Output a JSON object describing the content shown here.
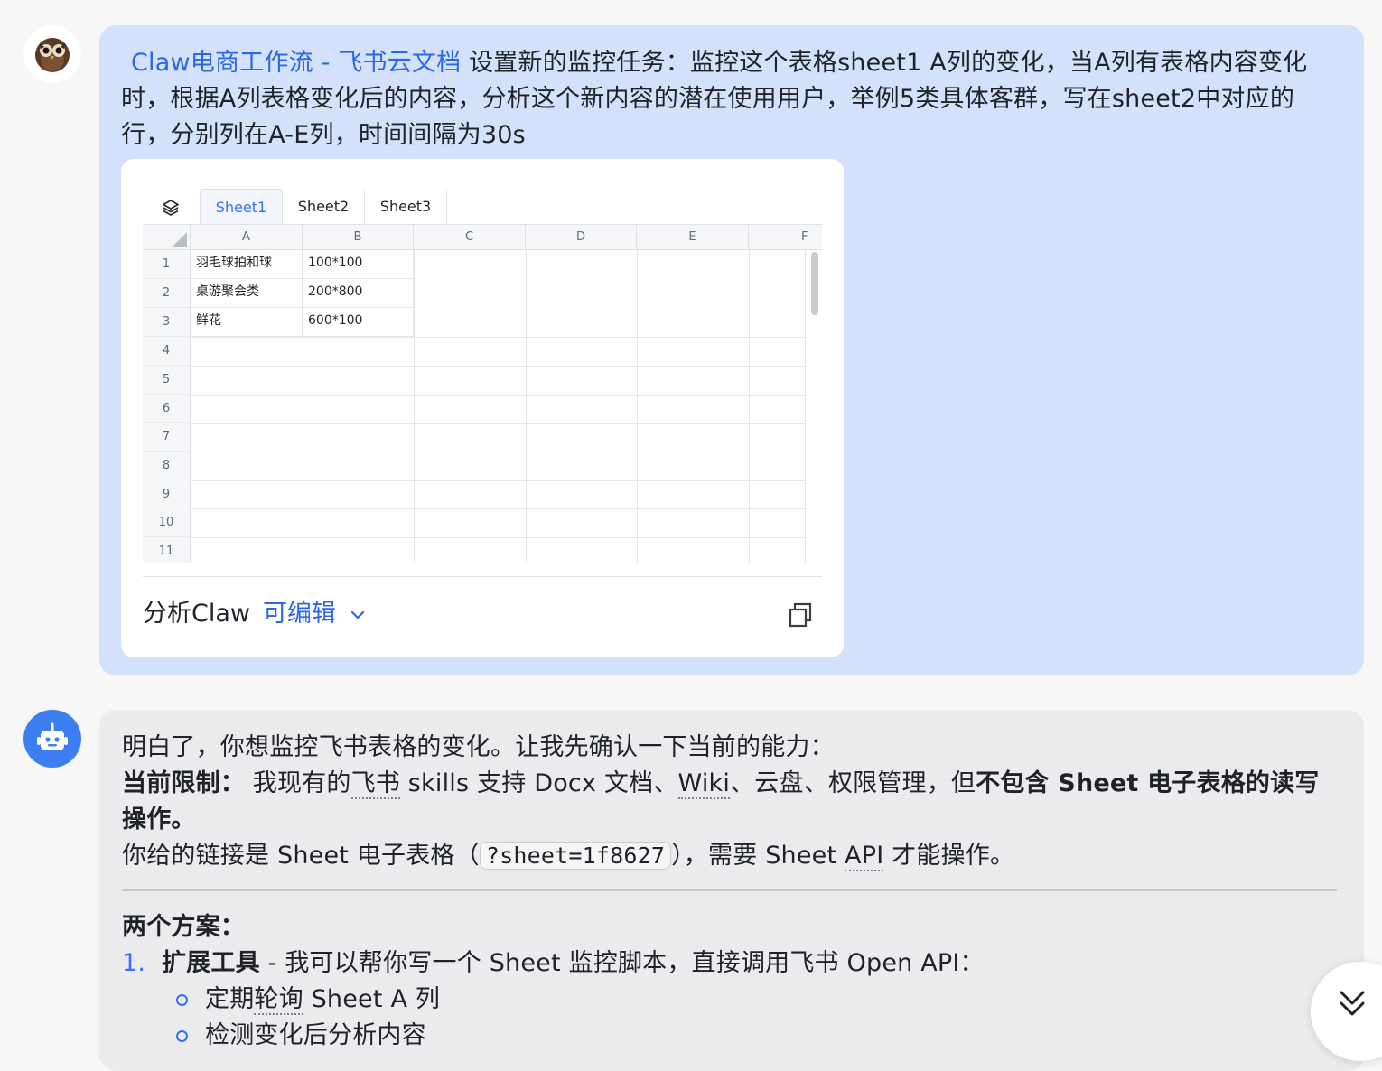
{
  "user_message": {
    "link_text": "Claw电商工作流 - 飞书云文档",
    "text": "设置新的监控任务：监控这个表格sheet1 A列的变化，当A列有表格内容变化时，根据A列表格变化后的内容，分析这个新内容的潜在使用用户，举例5类具体客群，写在sheet2中对应的行，分别列在A-E列，时间间隔为30s"
  },
  "doc_card": {
    "tabs": [
      "Sheet1",
      "Sheet2",
      "Sheet3"
    ],
    "active_tab": "Sheet1",
    "columns": [
      "A",
      "B",
      "C",
      "D",
      "E",
      "F"
    ],
    "row_numbers": [
      "1",
      "2",
      "3",
      "4",
      "5",
      "6",
      "7",
      "8",
      "9",
      "10",
      "11"
    ],
    "rows": [
      [
        "羽毛球拍和球",
        "100*100"
      ],
      [
        "桌游聚会类",
        "200*800"
      ],
      [
        "鲜花",
        "600*100"
      ]
    ],
    "doc_title": "分析Claw",
    "permission": "可编辑"
  },
  "bot_message": {
    "intro": "明白了，你想监控飞书表格的变化。让我先确认一下当前的能力：",
    "limit_label": "当前限制：",
    "limit_pre": " 我现有的",
    "limit_feishu": "飞书",
    "limit_mid": " skills 支持 Docx 文档、",
    "limit_wiki": "Wiki",
    "limit_post": "、云盘、权限管理，但",
    "limit_bold": "不包含 Sheet 电子表格的读写操作",
    "limit_end": "。",
    "link_pre": "你给的链接是 Sheet 电子表格（",
    "code": "?sheet=1f8627",
    "link_post": "），需要 Sheet ",
    "link_api": "API",
    "link_end": " 才能操作。",
    "plans_title": "两个方案：",
    "plan1_num": "1.",
    "plan1_bold": "扩展工具",
    "plan1_text": " - 我可以帮你写一个 Sheet 监控脚本，直接调用飞书 Open API：",
    "sub1_pre": "定期",
    "sub1_dotted": "轮询",
    "sub1_post": " Sheet A 列",
    "sub2": "检测变化后分析内容"
  },
  "colors": {
    "user_bubble": "#d4e1fa",
    "bot_bubble": "#ebebed",
    "accent": "#2c67e8",
    "bot_avatar": "#3d7ef0"
  }
}
